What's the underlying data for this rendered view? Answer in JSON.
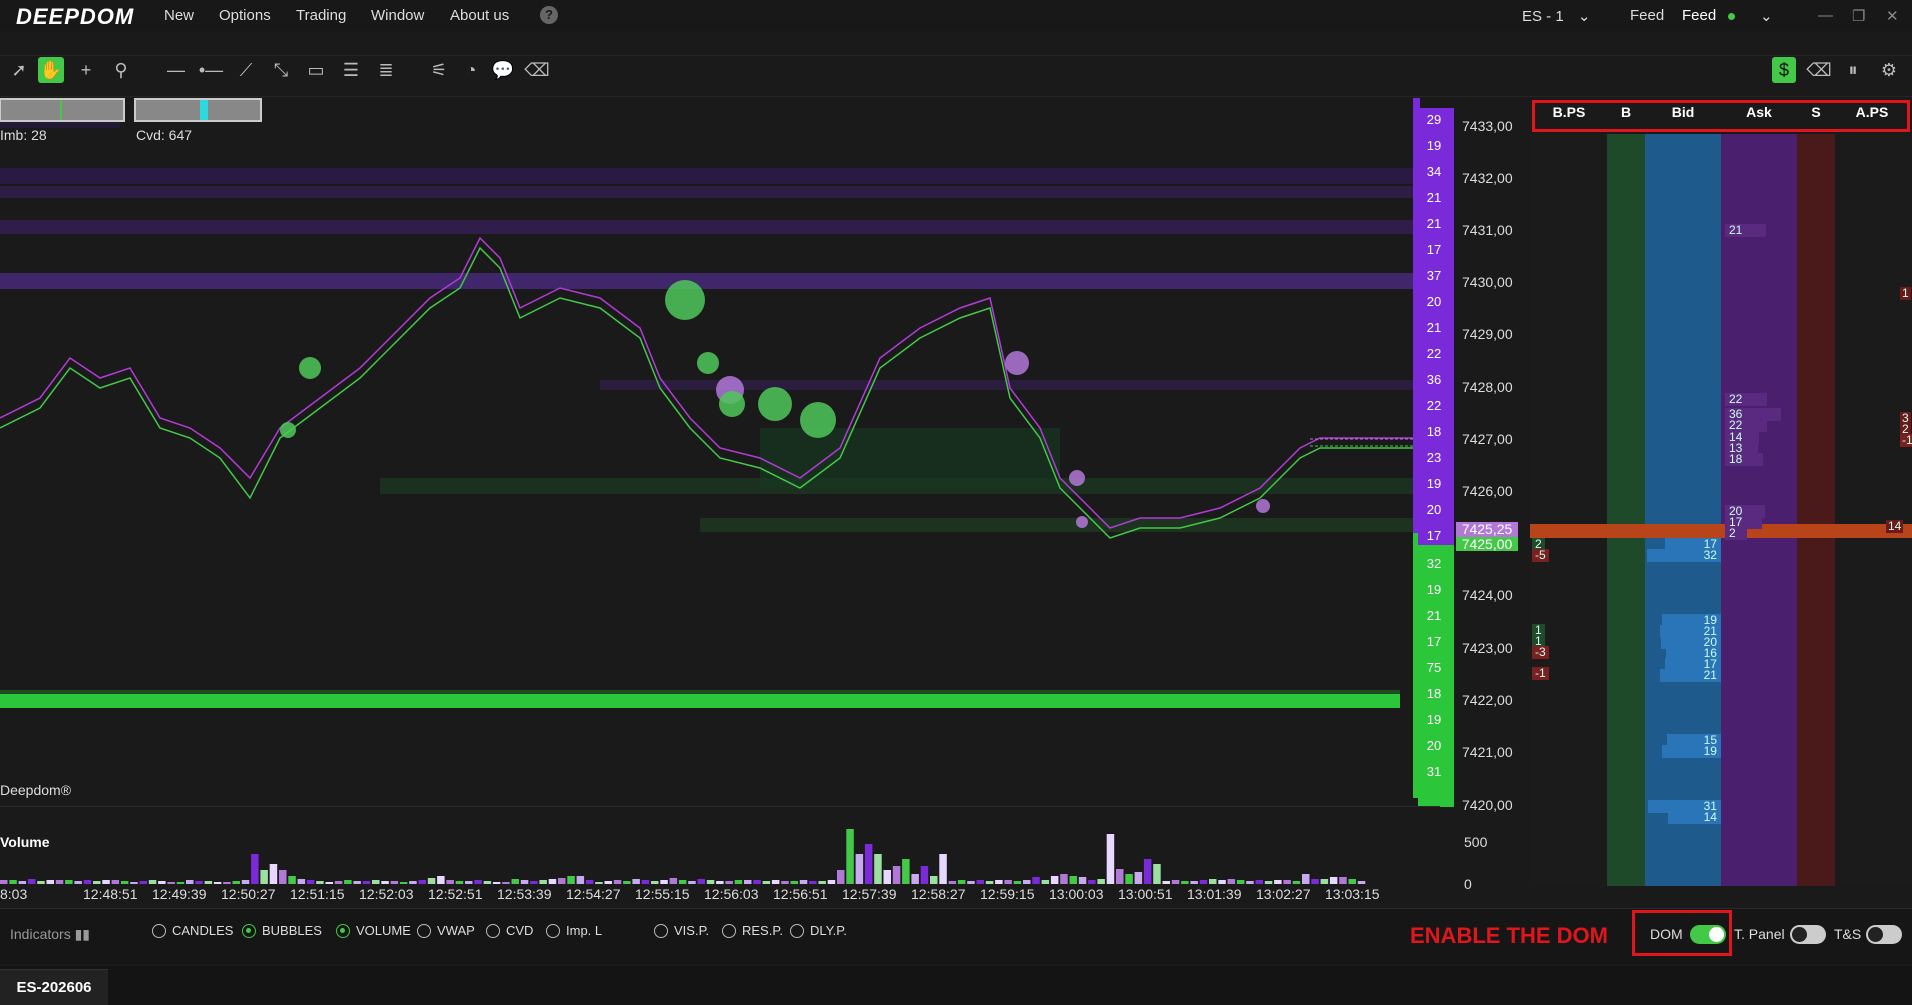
{
  "app": {
    "logo": "DEEPDOM",
    "menu": [
      "New",
      "Options",
      "Trading",
      "Window",
      "About us"
    ],
    "help_icon": "question-circle-icon",
    "instrument": "ES - 1",
    "feed_label": "Feed",
    "feed_status": "Feed",
    "feed_status_color": "#43c848"
  },
  "toolbar": {
    "tools": [
      "pointer-icon",
      "hand-icon",
      "crosshair-icon",
      "zoom-icon",
      "hline-icon",
      "ray-icon",
      "trendline-icon",
      "measure-icon",
      "rectangle-icon",
      "fib-icon",
      "levels-icon",
      "settings-sliders-icon",
      "timer-icon",
      "comment-icon",
      "eraser-icon"
    ],
    "right_tools": [
      "dollar-icon",
      "eraser-icon",
      "pause-icon",
      "settings-icon"
    ]
  },
  "indicators": {
    "imb_label": "Imb: 28",
    "cvd_label": "Cvd: 647"
  },
  "chart": {
    "watermark": "Deepdom®",
    "volume_label": "Volume",
    "volume_axis": [
      "500",
      "0"
    ],
    "last_price": "7425,25",
    "bid_price": "7425,00",
    "prices": [
      "7433,00",
      "7432,00",
      "7431,00",
      "7430,00",
      "7429,00",
      "7428,00",
      "7427,00",
      "7426,00",
      "7424,00",
      "7423,00",
      "7422,00",
      "7421,00",
      "7420,00"
    ],
    "times": [
      "8:03",
      "12:48:51",
      "12:49:39",
      "12:50:27",
      "12:51:15",
      "12:52:03",
      "12:52:51",
      "12:53:39",
      "12:54:27",
      "12:55:15",
      "12:56:03",
      "12:56:51",
      "12:57:39",
      "12:58:27",
      "12:59:15",
      "13:00:03",
      "13:00:51",
      "13:01:39",
      "13:02:27",
      "13:03:15"
    ],
    "profile_ask": [
      "29",
      "19",
      "34",
      "21",
      "21",
      "17",
      "37",
      "20",
      "21",
      "22",
      "36",
      "22",
      "18",
      "23",
      "19",
      "20",
      "17"
    ],
    "profile_bid": [
      "32",
      "19",
      "21",
      "17",
      "75",
      "18",
      "19",
      "20",
      "31"
    ]
  },
  "dom": {
    "headers": [
      "B.PS",
      "B",
      "Bid",
      "Ask",
      "S",
      "A.PS"
    ],
    "ask_values": [
      "21",
      "22",
      "36",
      "22",
      "14",
      "13",
      "18",
      "20",
      "17",
      "2"
    ],
    "bid_values": [
      "17",
      "32",
      "19",
      "21",
      "20",
      "16",
      "17",
      "21",
      "15",
      "19",
      "31",
      "14"
    ],
    "bps_values": [
      "2",
      "-5",
      "1",
      "1",
      "-3",
      "-1"
    ],
    "aps_values": [
      "1",
      "3",
      "2",
      "-1",
      "14"
    ],
    "colors": {
      "b": "#1f4a2a",
      "bid": "#1f5a8c",
      "ask": "#4a1f6e",
      "s": "#4a1a1a",
      "last": "#b8451a"
    }
  },
  "bottom": {
    "indicators_label": "Indicators",
    "options": [
      {
        "label": "CANDLES",
        "on": false
      },
      {
        "label": "BUBBLES",
        "on": true
      },
      {
        "label": "VOLUME",
        "on": true
      },
      {
        "label": "VWAP",
        "on": false
      },
      {
        "label": "CVD",
        "on": false
      },
      {
        "label": "Imp. L",
        "on": false
      },
      {
        "label": "VIS.P.",
        "on": false
      },
      {
        "label": "RES.P.",
        "on": false
      },
      {
        "label": "DLY.P.",
        "on": false
      }
    ],
    "callout": "ENABLE THE DOM",
    "dom_toggle": "DOM",
    "tpanel_toggle": "T. Panel",
    "ts_toggle": "T&S"
  },
  "tabs": [
    "ES-202606"
  ]
}
